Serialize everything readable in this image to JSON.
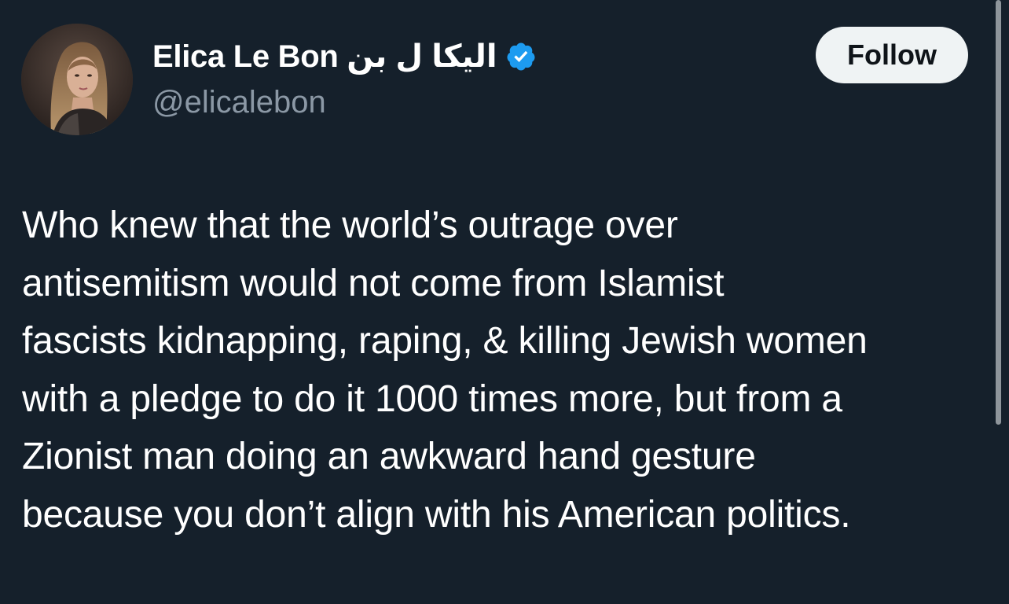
{
  "tweet": {
    "author": {
      "display_name": "Elica Le Bon الیکا ل بن",
      "handle": "@elicalebon",
      "verified_icon": "verified-badge-icon",
      "verified_color": "#1d9bf0"
    },
    "follow_label": "Follow",
    "text_lines": [
      "Who knew that the world’s outrage over",
      "antisemitism would not come from Islamist",
      "fascists kidnapping, raping, & killing Jewish women",
      "with a pledge to do it 1000 times more, but from a",
      "Zionist man doing an awkward hand gesture",
      "because you don’t align with his American politics."
    ]
  },
  "colors": {
    "background": "#15202b",
    "secondary_text": "#8b98a5",
    "button_bg": "#eff3f4"
  }
}
